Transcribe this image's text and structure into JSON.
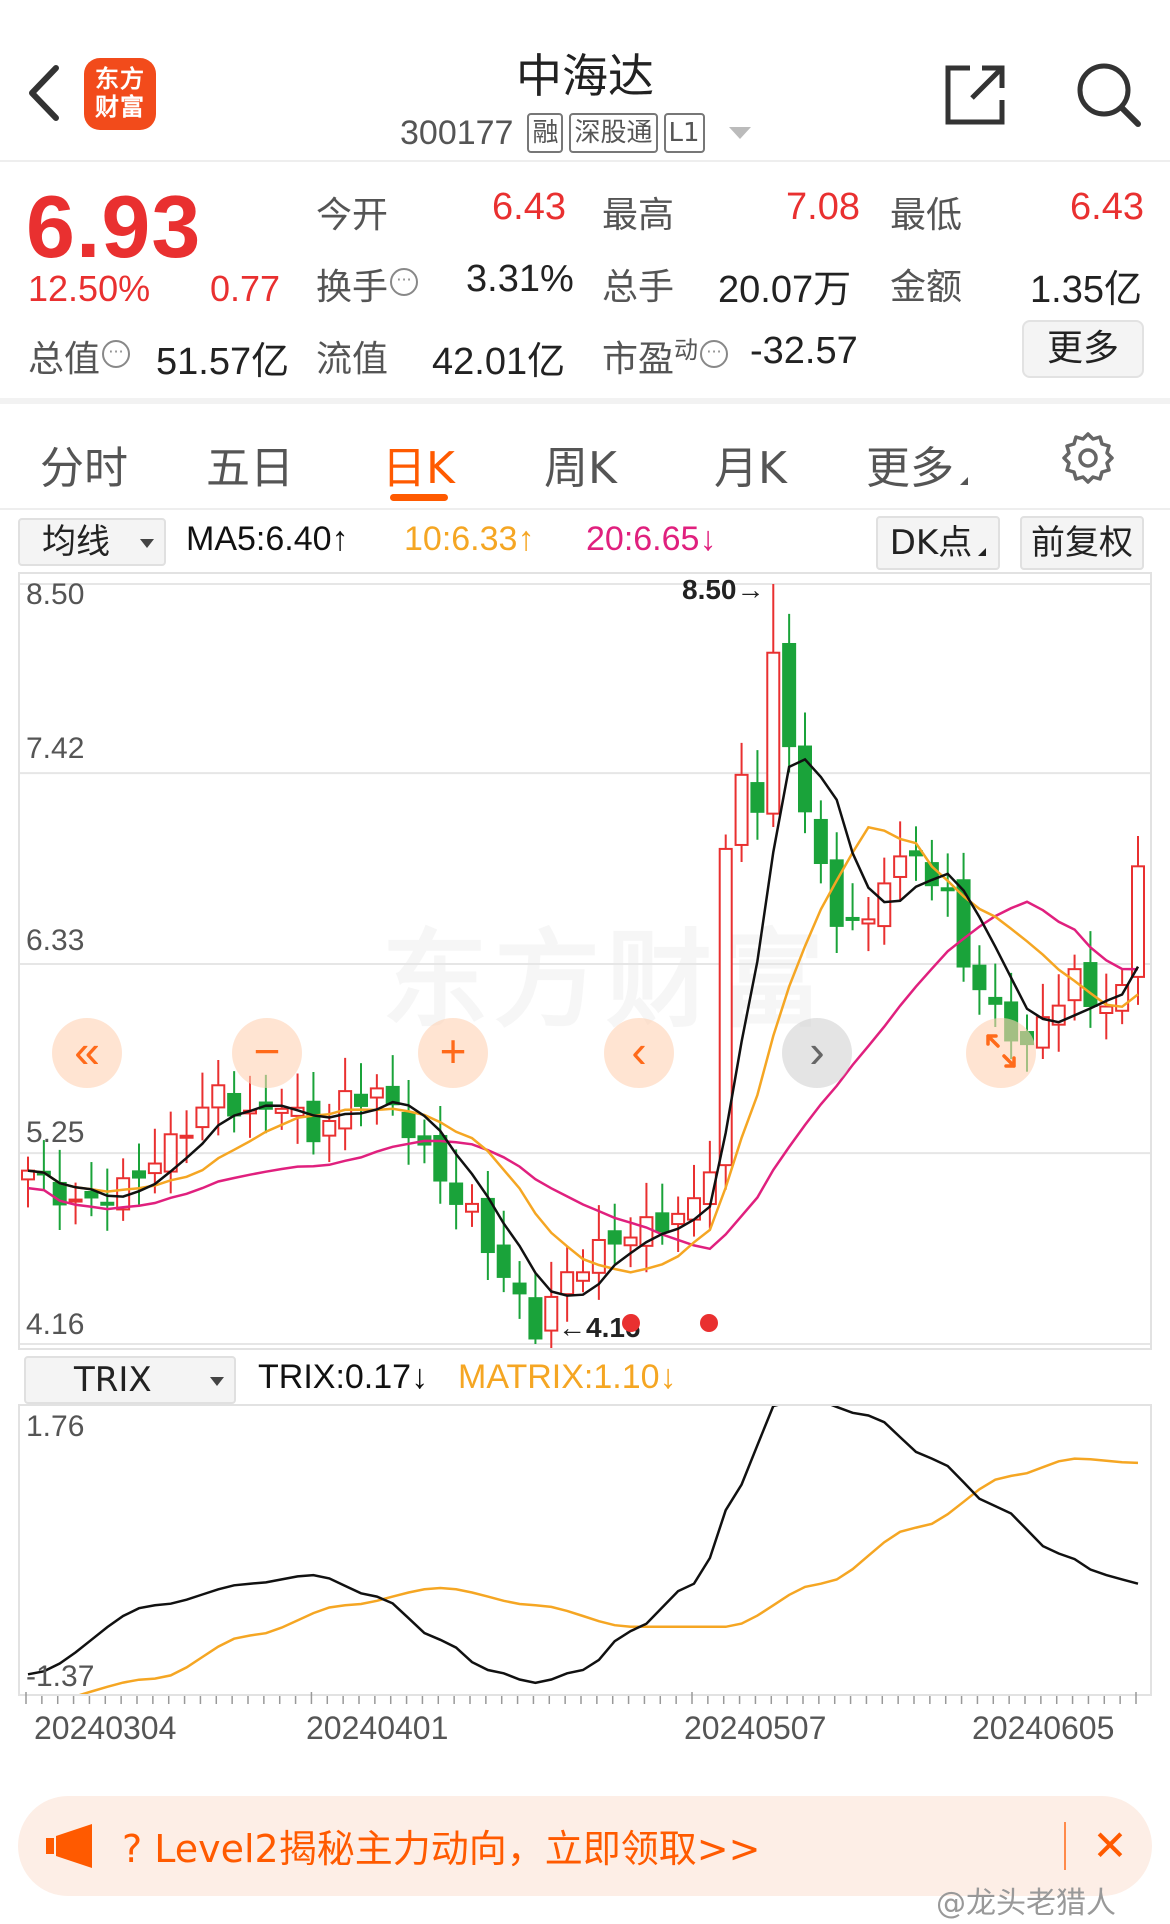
{
  "header": {
    "app_logo": "东方\n财富",
    "stock_name": "中海达",
    "stock_code": "300177",
    "tags": [
      "融",
      "深股通",
      "L1"
    ]
  },
  "quote": {
    "price": "6.93",
    "change_pct": "12.50%",
    "change": "0.77",
    "open_label": "今开",
    "open": "6.43",
    "high_label": "最高",
    "high": "7.08",
    "low_label": "最低",
    "low": "6.43",
    "turnover_label": "换手",
    "turnover": "3.31%",
    "volume_label": "总手",
    "volume": "20.07万",
    "amount_label": "金额",
    "amount": "1.35亿",
    "mcap_label": "总值",
    "mcap": "51.57亿",
    "float_label": "流值",
    "float_cap": "42.01亿",
    "pe_label": "市盈",
    "pe_sup": "动",
    "pe": "-32.57",
    "more_button": "更多",
    "up_color": "#e93030",
    "down_color": "#1aa33a"
  },
  "tabs": [
    {
      "label": "分时"
    },
    {
      "label": "五日"
    },
    {
      "label": "日K",
      "active": true
    },
    {
      "label": "周K"
    },
    {
      "label": "月K"
    },
    {
      "label": "更多"
    }
  ],
  "indicators": {
    "ma_selector": "均线",
    "ma5": "MA5:6.40↑",
    "ma10": "10:6.33↑",
    "ma20": "20:6.65↓",
    "dk_button": "DK点",
    "adjust_button": "前复权",
    "trix_selector": "TRIX",
    "trix": "TRIX:0.17↓",
    "matrix": "MATRIX:1.10↓"
  },
  "chart_data": [
    {
      "type": "candlestick",
      "y_ticks": [
        "8.50",
        "7.42",
        "6.33",
        "5.25",
        "4.16"
      ],
      "ylim": [
        4.16,
        8.5
      ],
      "max_label": "8.50→",
      "min_label": "←4.16",
      "series_colors": {
        "MA5": "#111111",
        "MA10": "#f5a623",
        "MA20": "#e0207e"
      }
    },
    {
      "type": "line",
      "y_ticks": [
        "1.76",
        "-1.37"
      ],
      "ylim": [
        -1.37,
        1.76
      ],
      "series_colors": {
        "TRIX": "#111111",
        "MATRIX": "#f5a623"
      }
    }
  ],
  "x_dates": [
    "20240304",
    "20240401",
    "20240507",
    "20240605"
  ],
  "promo": {
    "text": "?  Level2揭秘主力动向，立即领取>>",
    "close": "✕"
  },
  "watermark": "东方财富",
  "weibo": "@龙头老猎人"
}
